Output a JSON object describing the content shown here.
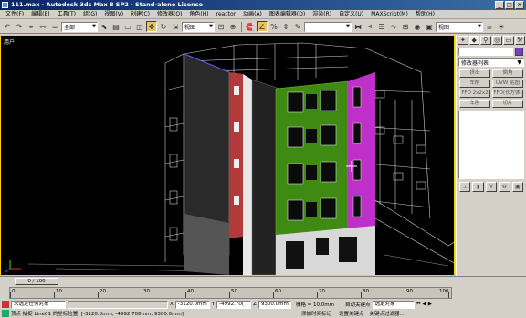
{
  "window": {
    "title": "111.max - Autodesk 3ds Max 8 SP2 - Stand-alone License"
  },
  "menu": [
    "文件(F)",
    "编辑(E)",
    "工具(T)",
    "组(G)",
    "视图(V)",
    "创建(C)",
    "修改器(O)",
    "角色(H)",
    "reactor",
    "动画(A)",
    "图表编辑器(D)",
    "渲染(R)",
    "自定义(U)",
    "MAXScript(M)",
    "帮助(H)"
  ],
  "toolbar": {
    "selection_filter": "全部",
    "reference_coord": "视图",
    "named_selection": "视图"
  },
  "viewport": {
    "label": "用户"
  },
  "command_panel": {
    "modifier_list_label": "修改器列表",
    "buttons": [
      "挤出",
      "倒角",
      "车削",
      "UVW 贴图",
      "FFD 2x2x2",
      "FFD(长方体)",
      "车削",
      "切片"
    ]
  },
  "timeline": {
    "slider": "0 / 100",
    "ticks": [
      "0",
      "10",
      "20",
      "30",
      "40",
      "50",
      "60",
      "70",
      "80",
      "90",
      "100"
    ]
  },
  "status": {
    "selection": "未选定任何对象",
    "x_label": "X",
    "x_value": "-3120.0mm",
    "y_label": "Y",
    "y_value": "-4992.70(",
    "z_label": "Z",
    "z_value": "9300.0mm",
    "grid": "栅格 = 10.0mm",
    "auto_key": "自动关键点",
    "key_mode": "选定对象",
    "prompt": "顶点 捕捉 Line01 的坐标位置: [-3120.0mm, -4992.708mm, 9300.0mm]",
    "add_time_tag": "添加时间标记",
    "set_key": "设置关键点",
    "key_filters": "关键点过滤器..."
  },
  "colors": {
    "accent": "#ffd000",
    "red_facade": "#b23a3a",
    "green_facade": "#3f8a12",
    "magenta_facade": "#c030c8"
  }
}
